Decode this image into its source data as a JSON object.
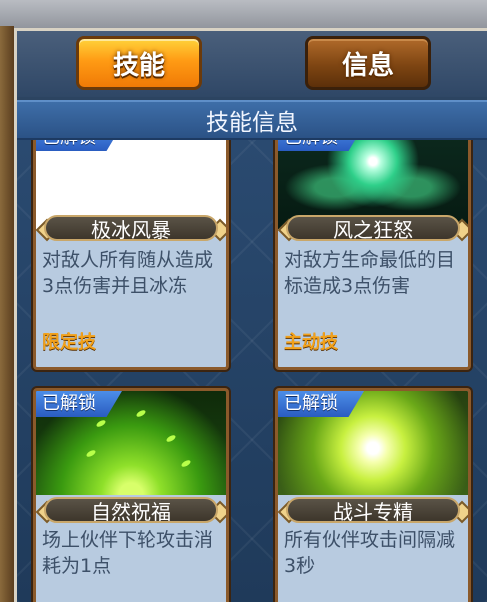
{
  "tabs": {
    "skill": "技能",
    "info": "信息"
  },
  "section_title": "技能信息",
  "cards": [
    {
      "badge": "已解锁",
      "name": "极冰风暴",
      "description": "对敌人所有随从造成3点伤害并且冰冻",
      "tag": "限定技",
      "image_icon": "blank-white"
    },
    {
      "badge": "已解锁",
      "name": "风之狂怒",
      "description": "对敌方生命最低的目标造成3点伤害",
      "tag": "主动技",
      "image_icon": "green-wind-vortex"
    },
    {
      "badge": "已解锁",
      "name": "自然祝福",
      "description": "场上伙伴下轮攻击消耗为1点",
      "tag": "",
      "image_icon": "green-leaves-glow"
    },
    {
      "badge": "已解锁",
      "name": "战斗专精",
      "description": "所有伙伴攻击间隔减3秒",
      "tag": "",
      "image_icon": "yellow-green-burst"
    }
  ]
}
